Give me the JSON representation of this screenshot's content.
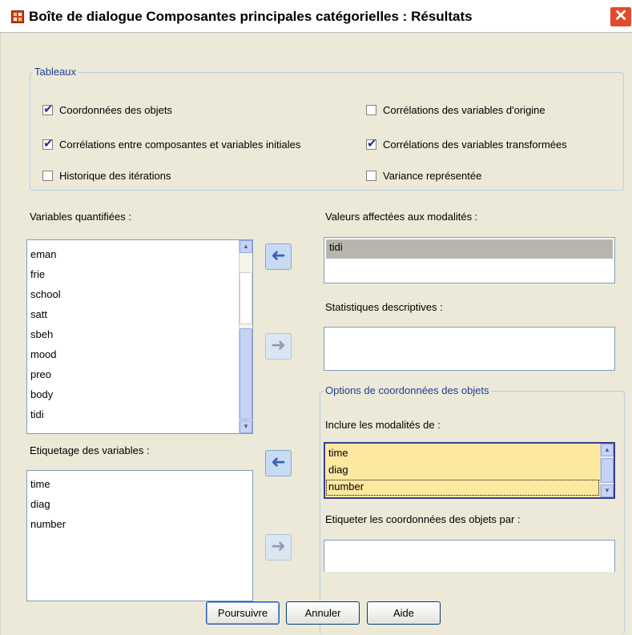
{
  "window": {
    "title": "Boîte de dialogue Composantes principales catégorielles : Résultats",
    "close_glyph": "✕"
  },
  "tableaux": {
    "legend": "Tableaux",
    "checkboxes": [
      {
        "label": "Coordonnées des objets",
        "checked": true
      },
      {
        "label": "Corrélations des variables d'origine",
        "checked": false
      },
      {
        "label": "Corrélations entre composantes et variables initiales",
        "checked": true
      },
      {
        "label": "Corrélations des variables transformées",
        "checked": true
      },
      {
        "label": "Historique des itérations",
        "checked": false
      },
      {
        "label": "Variance représentée",
        "checked": false
      }
    ]
  },
  "quantified": {
    "label": "Variables quantifiées :",
    "items": [
      "eman",
      "frie",
      "school",
      "satt",
      "sbeh",
      "mood",
      "preo",
      "body",
      "tidi"
    ]
  },
  "assigned_values": {
    "label": "Valeurs affectées aux modalités :",
    "items": [
      "tidi"
    ]
  },
  "descriptives": {
    "label": "Statistiques descriptives :",
    "items": []
  },
  "labeling": {
    "label": "Etiquetage des variables :",
    "items": [
      "time",
      "diag",
      "number"
    ]
  },
  "object_options": {
    "legend": "Options de coordonnées des objets",
    "include_label": "Inclure les modalités de :",
    "include_items": [
      "time",
      "diag",
      "number"
    ],
    "label_by_label": "Etiqueter les coordonnées des objets par :"
  },
  "buttons": {
    "continue": "Poursuivre",
    "cancel": "Annuler",
    "help": "Aide"
  },
  "arrows": {
    "move": "➜",
    "back": "➜"
  },
  "colors": {
    "dialog_bg": "#ece9d8",
    "accent_blue": "#1f3f8f",
    "selection_yellow": "#fde8a0",
    "close_red": "#e34a2c"
  }
}
